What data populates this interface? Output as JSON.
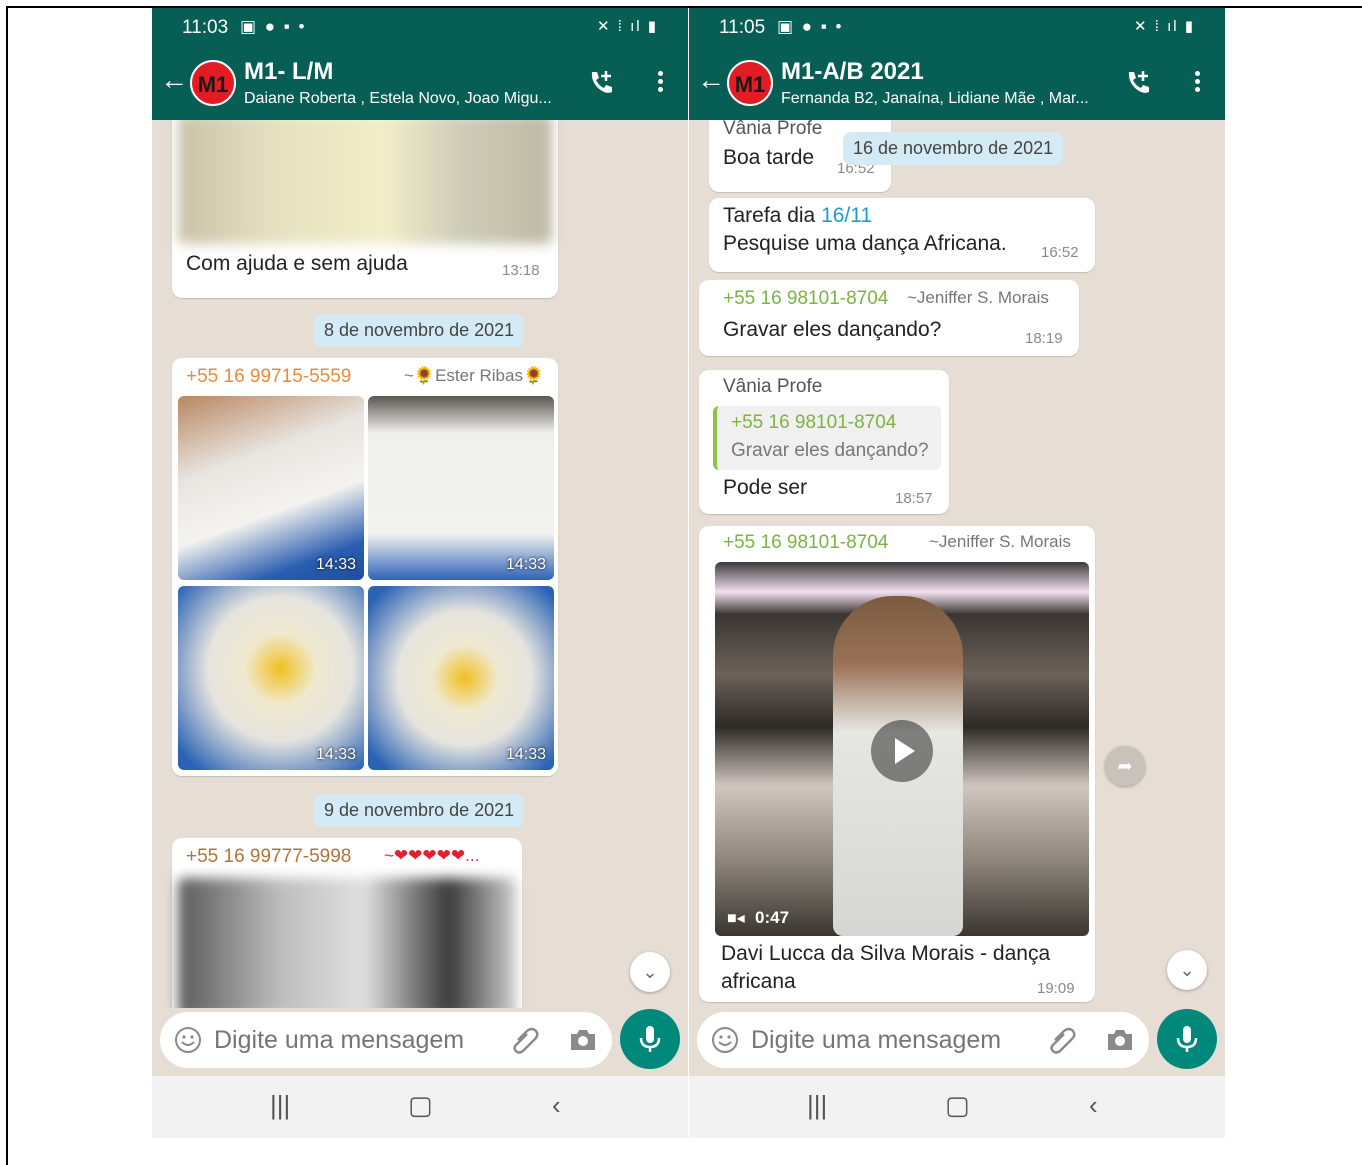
{
  "colors": {
    "header": "#075e54",
    "accent": "#00897b",
    "date_pill": "#d4eaf4",
    "green_sender": "#7cb342",
    "orange_sender": "#e88b3c"
  },
  "left": {
    "status": {
      "time": "11:03"
    },
    "header": {
      "avatar": "M1",
      "title": "M1- L/M",
      "subtitle": "Daiane Roberta , Estela Novo, Joao Migu..."
    },
    "msg1": {
      "text": "Com ajuda e sem ajuda",
      "time": "13:18"
    },
    "date1": "8 de novembro de 2021",
    "msg2": {
      "phone": "+55 16 99715-5559",
      "name": "~🌻Ester Ribas🌻",
      "photo_times": [
        "14:33",
        "14:33",
        "14:33",
        "14:33"
      ]
    },
    "date2": "9 de novembro de 2021",
    "msg3": {
      "phone": "+55 16 99777-5998",
      "name": "~❤❤❤❤❤..."
    },
    "input": {
      "placeholder": "Digite uma mensagem"
    }
  },
  "right": {
    "status": {
      "time": "11:05"
    },
    "header": {
      "avatar": "M1",
      "title": "M1-A/B 2021",
      "subtitle": "Fernanda B2, Janaína, Lidiane Mãe , Mar..."
    },
    "msg1": {
      "sender": "Vânia Profe",
      "text": "Boa tarde",
      "time": "16:52"
    },
    "date1": "16 de novembro de 2021",
    "msg2": {
      "line1": "Tarefa dia ",
      "link": "16/11",
      "line2": "Pesquise uma dança Africana.",
      "time": "16:52"
    },
    "msg3": {
      "phone": "+55 16 98101-8704",
      "name": "~Jeniffer S. Morais",
      "text": "Gravar eles dançando?",
      "time": "18:19"
    },
    "msg4": {
      "sender": "Vânia Profe",
      "quote_phone": "+55 16 98101-8704",
      "quote_text": "Gravar eles dançando?",
      "text": "Pode ser",
      "time": "18:57"
    },
    "msg5": {
      "phone": "+55 16 98101-8704",
      "name": "~Jeniffer S. Morais",
      "duration": "0:47",
      "caption1": "Davi Lucca da Silva Morais - dança",
      "caption2": "africana",
      "time": "19:09"
    },
    "input": {
      "placeholder": "Digite uma mensagem"
    }
  }
}
